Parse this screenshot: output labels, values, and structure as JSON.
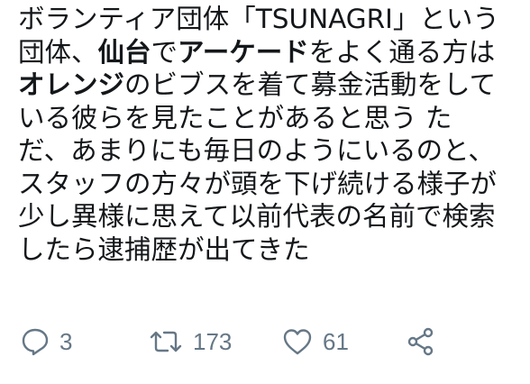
{
  "tweet": {
    "lines": [
      [
        {
          "text": "ボランティア団体「TSUNAGRI」という",
          "bold": false
        }
      ],
      [
        {
          "text": "団体、",
          "bold": false
        },
        {
          "text": "仙台",
          "bold": true
        },
        {
          "text": "で",
          "bold": false
        },
        {
          "text": "アーケード",
          "bold": true
        },
        {
          "text": "をよく通る方は",
          "bold": false
        }
      ],
      [
        {
          "text": "オレンジ",
          "bold": true
        },
        {
          "text": "のビブスを着て募金活動をして",
          "bold": false
        }
      ],
      [
        {
          "text": "いる彼らを見たことがあると思う  た",
          "bold": false
        }
      ],
      [
        {
          "text": "だ、あまりにも毎日のようにいるのと、",
          "bold": false
        }
      ],
      [
        {
          "text": "スタッフの方々が頭を下げ続ける様子が",
          "bold": false
        }
      ],
      [
        {
          "text": "少し異様に思えて以前代表の名前で検索",
          "bold": false
        }
      ],
      [
        {
          "text": "したら逮捕歴が出てきた",
          "bold": false
        }
      ]
    ]
  },
  "actions": {
    "reply": {
      "icon": "reply-icon",
      "count": "3"
    },
    "retweet": {
      "icon": "retweet-icon",
      "count": "173"
    },
    "like": {
      "icon": "heart-icon",
      "count": "61"
    },
    "share": {
      "icon": "share-icon"
    }
  },
  "colors": {
    "text": "#14171a",
    "icon": "#657786"
  }
}
